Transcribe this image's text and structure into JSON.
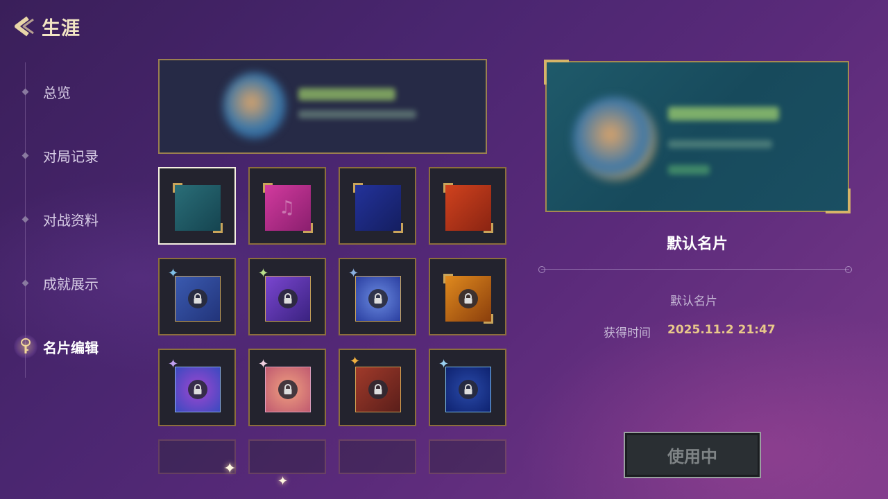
{
  "header": {
    "title": "生涯",
    "back_icon": "chevron-left-icon"
  },
  "sidebar": {
    "items": [
      {
        "label": "总览",
        "active": false
      },
      {
        "label": "对局记录",
        "active": false
      },
      {
        "label": "对战资料",
        "active": false
      },
      {
        "label": "成就展示",
        "active": false
      },
      {
        "label": "名片编辑",
        "active": true,
        "icon": "key-icon"
      }
    ]
  },
  "grid": {
    "tiles": [
      {
        "id": "teal",
        "color": "#1f5a64",
        "locked": false,
        "selected": true
      },
      {
        "id": "pink-music",
        "color": "#b02d8a",
        "locked": false,
        "selected": false
      },
      {
        "id": "navy",
        "color": "#1c2a78",
        "locked": false,
        "selected": false
      },
      {
        "id": "red",
        "color": "#b53318",
        "locked": false,
        "selected": false
      },
      {
        "id": "blue-cat",
        "color": "#2e4e9a",
        "locked": true
      },
      {
        "id": "purple-cat",
        "color": "#6a3ab8",
        "locked": true
      },
      {
        "id": "blue-swirl",
        "color": "#3a5ac0",
        "locked": true
      },
      {
        "id": "orange",
        "color": "#c0660e",
        "locked": true
      },
      {
        "id": "violet-cat",
        "color": "#5a4ad0",
        "locked": true
      },
      {
        "id": "peach-fox",
        "color": "#d8706a",
        "locked": true
      },
      {
        "id": "brown-gold",
        "color": "#8a2e22",
        "locked": true
      },
      {
        "id": "deep-blue",
        "color": "#1a3e9a",
        "locked": true
      }
    ]
  },
  "detail": {
    "card_name": "默认名片",
    "description": "默认名片",
    "time_label": "获得时间",
    "time_value": "2025.11.2  21:47",
    "use_button_label": "使用中"
  }
}
